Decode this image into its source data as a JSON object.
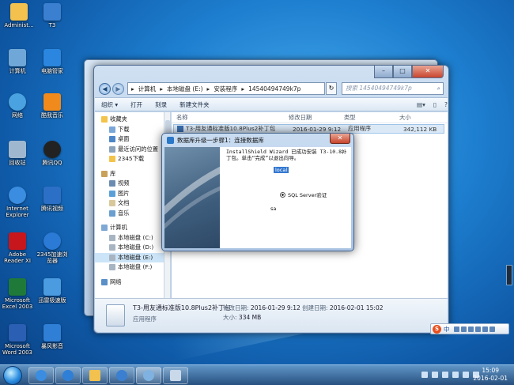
{
  "desktop": {
    "icons": [
      {
        "label": "Administ...",
        "color": "#f2c14e"
      },
      {
        "label": "T3",
        "color": "#3b7fd0"
      },
      {
        "label": "计算机",
        "color": "#6fa7d8"
      },
      {
        "label": "电脑管家",
        "color": "#2a86de"
      },
      {
        "label": "网络",
        "color": "#4aa3e0"
      },
      {
        "label": "酷我音乐",
        "color": "#f08a1c"
      },
      {
        "label": "回收站",
        "color": "#9fb8d0"
      },
      {
        "label": "腾讯QQ",
        "color": "#222222"
      },
      {
        "label": "Internet Explorer",
        "color": "#3a8de0"
      },
      {
        "label": "腾讯视频",
        "color": "#2b6fc6"
      },
      {
        "label": "Adobe Reader XI",
        "color": "#c8161d"
      },
      {
        "label": "2345加速浏览器",
        "color": "#2a7ad6"
      },
      {
        "label": "Microsoft Excel 2003",
        "color": "#1f7a3a"
      },
      {
        "label": "迅雷极速版",
        "color": "#4a9be0"
      },
      {
        "label": "Microsoft Word 2003",
        "color": "#2b5fb3"
      },
      {
        "label": "暴风影音",
        "color": "#2f7fd6"
      }
    ]
  },
  "explorer": {
    "breadcrumb": [
      "计算机",
      "本地磁盘 (E:)",
      "安装程序",
      "1454049474​9k7p"
    ],
    "search_placeholder": "搜索 1454049474​9k7p",
    "toolbar": {
      "organize": "组织 ▾",
      "open": "打开",
      "burn": "刻录",
      "new_folder": "新建文件夹"
    },
    "nav": {
      "favorites": "收藏夹",
      "downloads": "下载",
      "desktop": "桌面",
      "recent": "最近访问的位置",
      "downloads2345": "2345下载",
      "libraries": "库",
      "videos": "视频",
      "pictures": "图片",
      "documents": "文档",
      "music": "音乐",
      "computer": "计算机",
      "drive_c": "本地磁盘 (C:)",
      "drive_d": "本地磁盘 (D:)",
      "drive_e": "本地磁盘 (E:)",
      "drive_f": "本地磁盘 (F:)",
      "network": "网络"
    },
    "columns": {
      "name": "名称",
      "modified": "修改日期",
      "type": "类型",
      "size": "大小"
    },
    "file": {
      "name": "T3-用友通标准版10.8Plus2补丁包",
      "modified": "2016-01-29 9:12",
      "type": "应用程序",
      "size": "342,112 KB"
    },
    "details": {
      "name": "T3-用友通标准版10.8Plus2补丁包",
      "modified_label": "修改日期:",
      "modified": "2016-01-29 9:12",
      "created_label": "创建日期:",
      "created": "2016-02-01 15:02",
      "type": "应用程序",
      "size_label": "大小:",
      "size": "334 MB"
    }
  },
  "dialog": {
    "title": "数据库升级一步骤1：连接数据库",
    "message": "InstallShield Wizard 已成功安装 T3-10.8补丁包。单击“完成”以退出向导。",
    "server": "local",
    "auth": "SQL Server验证",
    "user": "sa"
  },
  "ime": {
    "label": "中"
  },
  "clock": {
    "time": "15:09",
    "date": "2016-02-01"
  }
}
